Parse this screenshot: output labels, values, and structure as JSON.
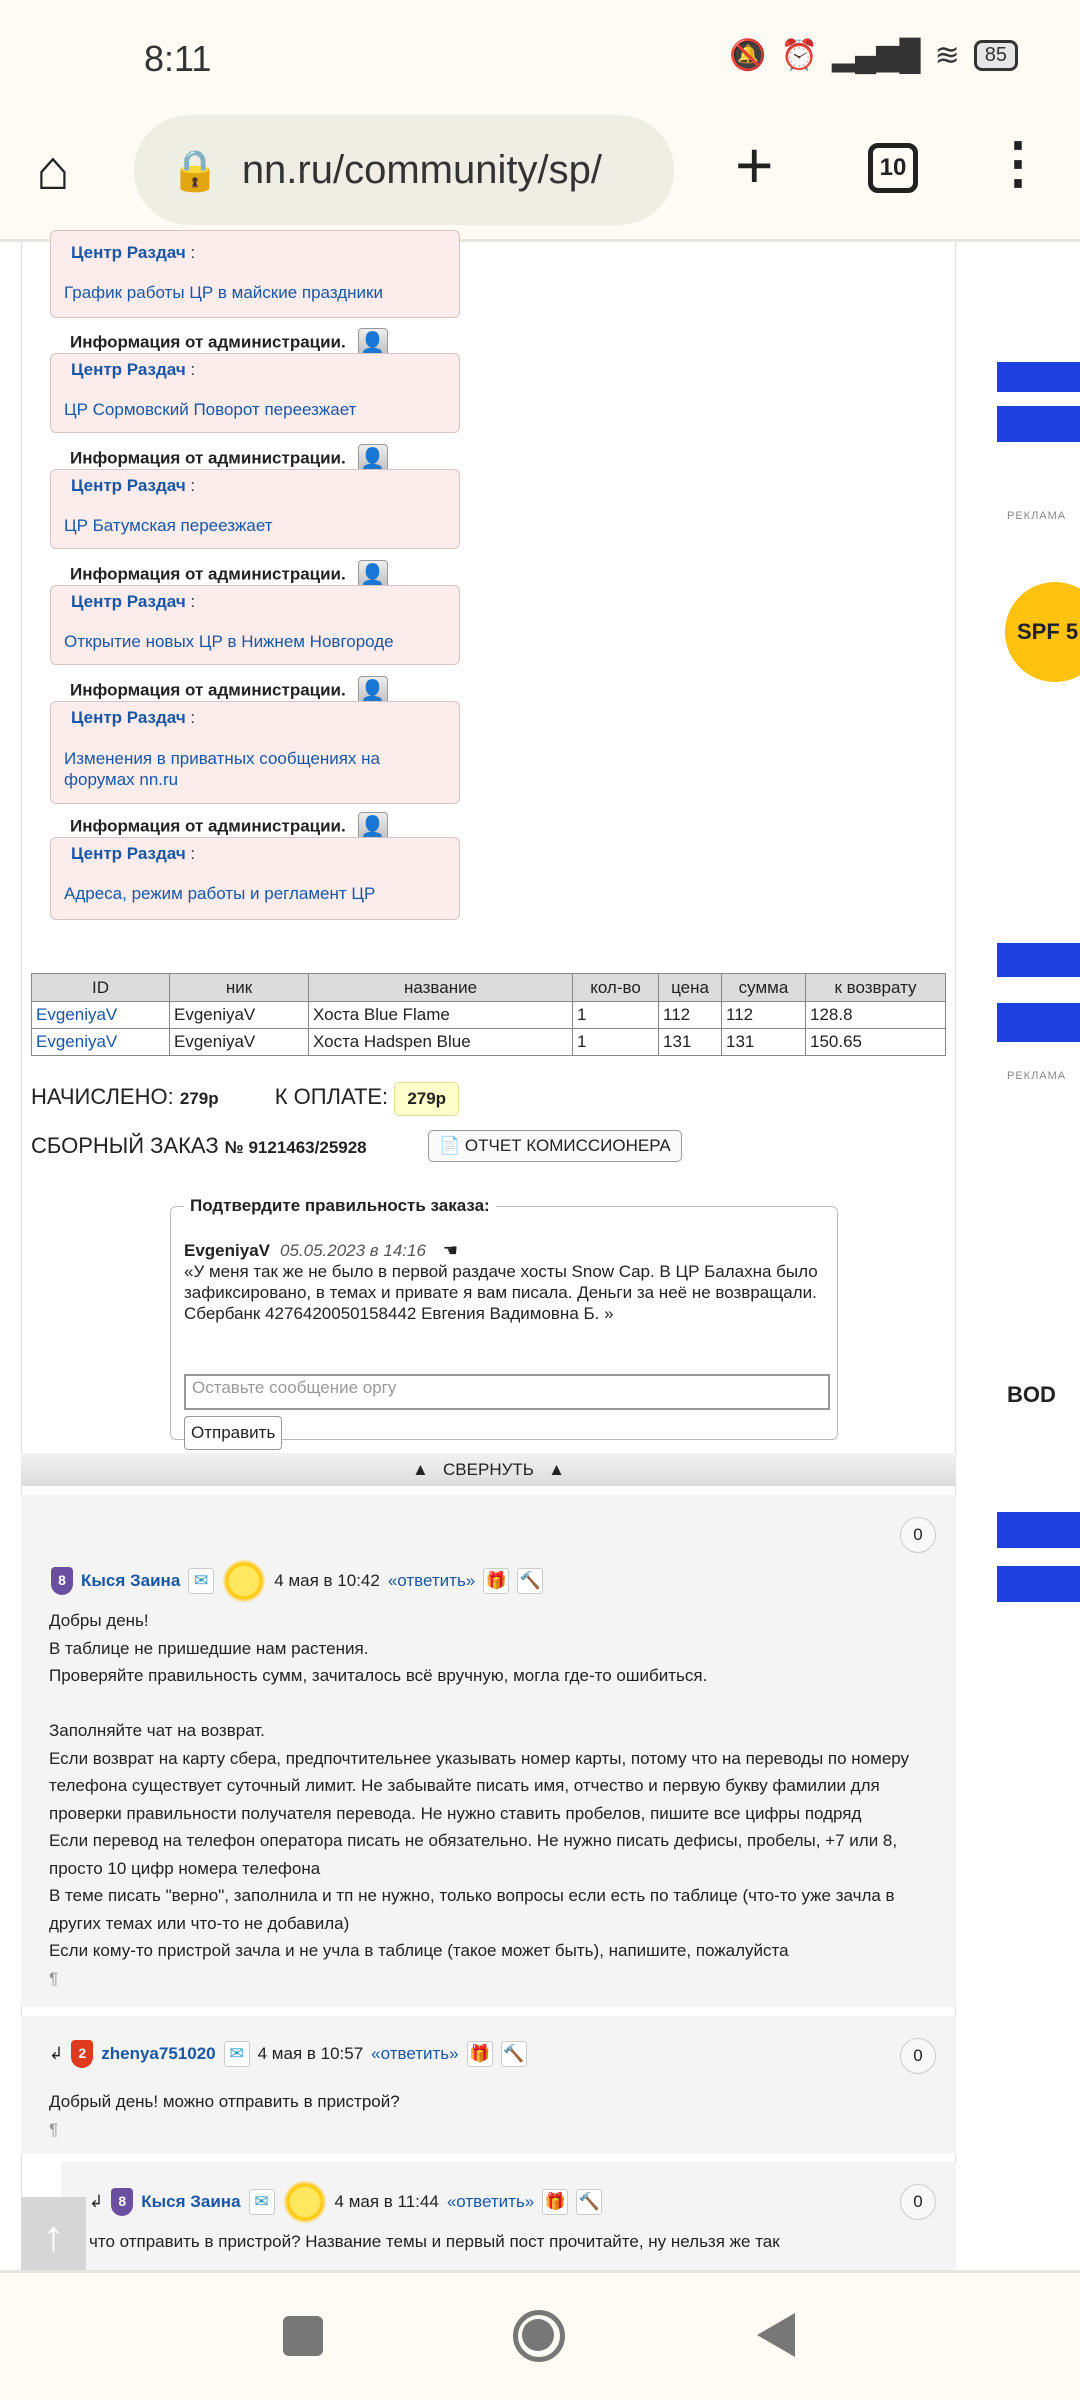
{
  "status_bar": {
    "time": "8:11",
    "battery": "85"
  },
  "browser": {
    "url": "nn.ru/community/sp/",
    "tab_count": "10"
  },
  "admin_notices": {
    "heading": "Информация от администрации.",
    "source": "Центр Раздач",
    "items": [
      "График работы ЦР в майские праздники",
      "ЦР Сормовский Поворот переезжает",
      "ЦР Батумская переезжает",
      "Открытие новых ЦР в Нижнем Новгороде",
      "Изменения в приватных сообщениях на форумах nn.ru",
      "Адреса, режим работы и регламент ЦР"
    ]
  },
  "order_table": {
    "headers": [
      "ID",
      "ник",
      "название",
      "кол-во",
      "цена",
      "сумма",
      "к возврату"
    ],
    "rows": [
      [
        "EvgeniyaV",
        "EvgeniyaV",
        "Хоста Blue Flame",
        "1",
        "112",
        "112",
        "128.8"
      ],
      [
        "EvgeniyaV",
        "EvgeniyaV",
        "Хоста Hadspen Blue",
        "1",
        "131",
        "131",
        "150.65"
      ]
    ]
  },
  "totals": {
    "accrued_label": "НАЧИСЛЕНО:",
    "accrued": "279р",
    "topay_label": "К ОПЛАТЕ:",
    "topay": "279р",
    "order_label": "СБОРНЫЙ ЗАКАЗ",
    "order_no": "№ 9121463/25928",
    "report_button": "ОТЧЕТ КОМИССИОНЕРА"
  },
  "confirm": {
    "legend": "Подтвердите правильность заказа:",
    "author": "EvgeniyaV",
    "date": "05.05.2023 в 14:16",
    "message": "«У меня так же не было в первой раздаче хосты Snow Cap. В ЦР Балахна было зафиксировано, в темах и привате я вам писала. Деньги за неё не возвращали.",
    "message2": "Сбербанк 4276420050158442 Евгения Вадимовна Б. »",
    "placeholder": "Оставьте сообщение оргу",
    "send": "Отправить"
  },
  "collapse": "СВЕРНУТЬ",
  "comments": [
    {
      "author": "Кыся Заина",
      "badge": "8",
      "date": "4 мая в 10:42",
      "reply": "«ответить»",
      "count": "0",
      "lines": [
        "Добры день!",
        "В таблице не пришедшие нам растения.",
        "Проверяйте правильность сумм, зачиталось всё вручную, могла где-то ошибиться.",
        "",
        "Заполняйте чат на возврат.",
        "Если возврат на карту сбера, предпочтительнее указывать номер карты, потому что на переводы по номеру",
        "телефона существует суточный лимит. Не забывайте писать имя, отчество и первую букву фамилии для",
        "проверки правильности получателя перевода. Не нужно ставить пробелов, пишите все цифры подряд",
        "Если перевод на телефон оператора писать не обязательно. Не нужно писать дефисы, пробелы, +7 или 8,",
        "просто 10 цифр номера телефона",
        "В теме писать \"верно\", заполнила и тп не нужно, только вопросы если есть по таблице (что-то уже зачла в",
        "других темах или что-то не добавила)",
        "Если кому-то пристрой зачла и не учла в таблице (такое может быть), напишите, пожалуйста"
      ]
    },
    {
      "author": "zhenya751020",
      "badge": "2",
      "date": "4 мая в 10:57",
      "reply": "«ответить»",
      "count": "0",
      "lines": [
        "Добрый день! можно отправить в пристрой?"
      ]
    },
    {
      "author": "Кыся Заина",
      "badge": "8",
      "date": "4 мая в 11:44",
      "reply": "«ответить»",
      "count": "0",
      "lines": [
        "что отправить в пристрой? Название темы и первый пост прочитайте, ну нельзя же так"
      ]
    }
  ],
  "ads": {
    "label": "РЕКЛАМА",
    "spf": "SPF 5",
    "bod": "BOD"
  },
  "colors": {
    "link": "#1a56a6",
    "notice_bg": "#fdecec",
    "comment_bg": "#f4f4f4",
    "chrome_bg": "#fdfbf3"
  }
}
